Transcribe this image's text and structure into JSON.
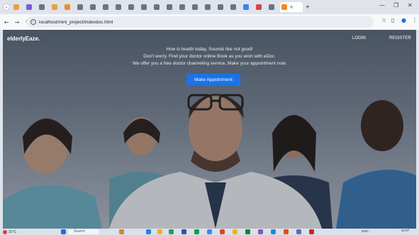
{
  "browser": {
    "tabs": [
      {
        "color": "#e8a13c"
      },
      {
        "color": "#7a5cd6"
      },
      {
        "color": "#6b7280"
      },
      {
        "color": "#e8a13c"
      },
      {
        "color": "#f08a24"
      },
      {
        "color": "#6b7280"
      },
      {
        "color": "#6b7280"
      },
      {
        "color": "#6b7280"
      },
      {
        "color": "#6b7280"
      },
      {
        "color": "#6b7280"
      },
      {
        "color": "#6b7280"
      },
      {
        "color": "#6b7280"
      },
      {
        "color": "#6b7280"
      },
      {
        "color": "#6b7280"
      },
      {
        "color": "#6b7280"
      },
      {
        "color": "#6b7280"
      },
      {
        "color": "#6b7280"
      },
      {
        "color": "#6b7280"
      },
      {
        "color": "#3b82f6"
      },
      {
        "color": "#d64545"
      },
      {
        "color": "#6b7280"
      },
      {
        "color": "#f08a24"
      }
    ],
    "active_tab_close": "×",
    "new_tab": "+",
    "minimize": "—",
    "maximize": "❐",
    "close": "✕",
    "url": "localhost/mini_project/indexdoc.html"
  },
  "page": {
    "brand": "elderlyEaze.",
    "nav": {
      "login": "LOGIN",
      "register": "REGISTER"
    },
    "hero": {
      "line1": "How is health today, Sounds like not good!",
      "line2": "Don't worry. Find your doctor online Book as you wish with eDoc.",
      "line3": "We offer you a free doctor channeling service, Make your appointment now."
    },
    "cta_label": "Make Appointment",
    "accent": "#1a73e8"
  },
  "taskbar": {
    "weather": "31°C",
    "search_placeholder": "Search",
    "lang": "ENG",
    "time": "22:07"
  }
}
